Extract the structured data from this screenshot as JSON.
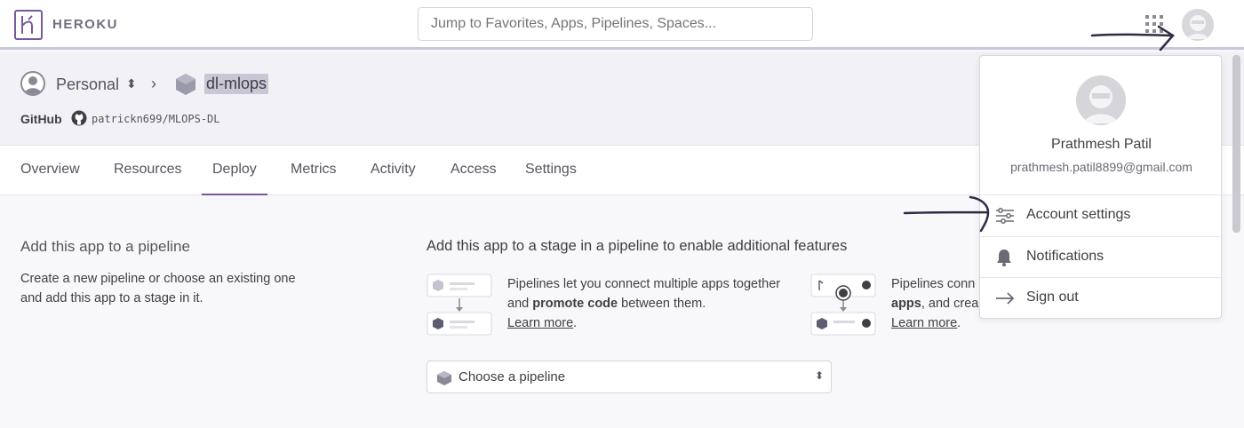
{
  "brand": {
    "logo_text": "HEROKU"
  },
  "search": {
    "placeholder": "Jump to Favorites, Apps, Pipelines, Spaces..."
  },
  "breadcrumb": {
    "owner": "Personal",
    "app_name": "dl-mlops"
  },
  "github": {
    "label": "GitHub",
    "repo": "patrickn699/MLOPS-DL"
  },
  "tabs": [
    {
      "label": "Overview"
    },
    {
      "label": "Resources"
    },
    {
      "label": "Deploy",
      "active": true
    },
    {
      "label": "Metrics"
    },
    {
      "label": "Activity"
    },
    {
      "label": "Access"
    },
    {
      "label": "Settings"
    }
  ],
  "pipeline_section": {
    "title": "Add this app to a pipeline",
    "description": "Create a new pipeline or choose an existing one and add this app to a stage in it.",
    "stage_title": "Add this app to a stage in a pipeline to enable additional features",
    "feature1": {
      "text_a": "Pipelines let you connect multiple apps together and ",
      "text_bold": "promote code",
      "text_b": " between them.",
      "link": "Learn more",
      "after_link": "."
    },
    "feature2": {
      "line1": "Pipelines conn",
      "bold": "apps",
      "line2": ", and crea",
      "link": "Learn more",
      "after_link": "."
    },
    "select_label": "Choose a pipeline"
  },
  "account_menu": {
    "name": "Prathmesh Patil",
    "email": "prathmesh.patil8899@gmail.com",
    "items": [
      {
        "label": "Account settings",
        "icon": "sliders-icon"
      },
      {
        "label": "Notifications",
        "icon": "bell-icon"
      },
      {
        "label": "Sign out",
        "icon": "arrow-right-icon"
      }
    ]
  },
  "colors": {
    "brand_purple": "#79589f",
    "text": "#3f3f44",
    "background": "#f7f7fb"
  }
}
